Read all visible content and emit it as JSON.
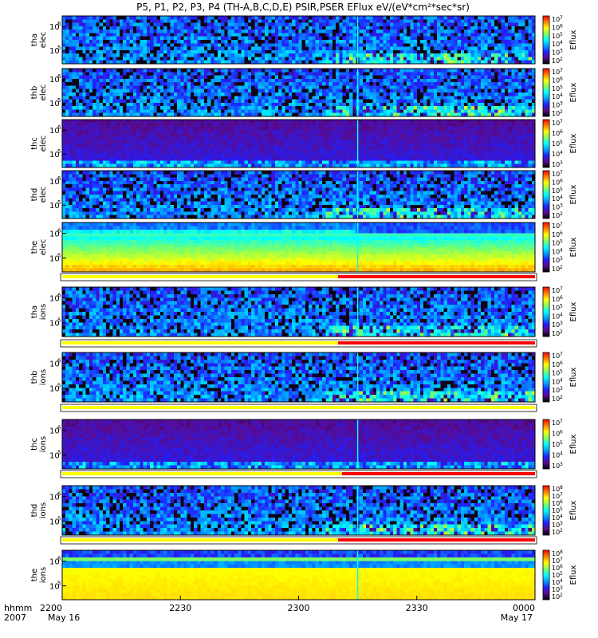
{
  "title": "P5, P1, P2, P3, P4 (TH-A,B,C,D,E) PSIR,PSER EFlux eV/(eV*cm²*sec*sr)",
  "colorbar_label": "Eflux",
  "colorbar_stops": [
    "#000000",
    "#5a0a8c",
    "#2020ff",
    "#00a0ff",
    "#00ffff",
    "#80ff60",
    "#ffff00",
    "#ff8000",
    "#ff0000"
  ],
  "bottom_axis": {
    "row1_left": "hhmm",
    "row2_left": "2007",
    "ticks": [
      "2200",
      "2230",
      "2300",
      "2330",
      "0000"
    ],
    "date_start": "May 16",
    "date_end": "May 17"
  },
  "chart_data": {
    "type": "heatmap",
    "x_range": [
      "2007-05-16 22:00",
      "2007-05-17 00:00"
    ],
    "event_time": "23:15",
    "panels": [
      {
        "ylabel_top": "tha",
        "ylabel_bot": "elec",
        "yticks": [
          "10",
          "10"
        ],
        "yexp": [
          "6",
          "5"
        ],
        "cbar_exps": [
          "7",
          "6",
          "5",
          "4",
          "3",
          "2"
        ],
        "base": "low",
        "has_status_bar": false
      },
      {
        "ylabel_top": "thb",
        "ylabel_bot": "elec",
        "yticks": [
          "10",
          "10"
        ],
        "yexp": [
          "6",
          "5"
        ],
        "cbar_exps": [
          "7",
          "6",
          "5",
          "4",
          "3",
          "2"
        ],
        "base": "low",
        "has_status_bar": false
      },
      {
        "ylabel_top": "thc",
        "ylabel_bot": "elec",
        "yticks": [
          "10",
          "10"
        ],
        "yexp": [
          "6",
          "5"
        ],
        "cbar_exps": [
          "7",
          "6",
          "5",
          "4",
          "3"
        ],
        "base": "purple",
        "has_status_bar": false
      },
      {
        "ylabel_top": "thd",
        "ylabel_bot": "elec",
        "yticks": [
          "10",
          "10"
        ],
        "yexp": [
          "6",
          "5"
        ],
        "cbar_exps": [
          "7",
          "6",
          "5",
          "4",
          "3",
          "2"
        ],
        "base": "low",
        "has_status_bar": false
      },
      {
        "ylabel_top": "the",
        "ylabel_bot": "elec",
        "yticks": [
          "10",
          "10"
        ],
        "yexp": [
          "6",
          "5"
        ],
        "cbar_exps": [
          "7",
          "6",
          "5",
          "4",
          "3",
          "2"
        ],
        "base": "sheath",
        "has_status_bar": true,
        "status_red_from": "23:10"
      },
      {
        "ylabel_top": "tha",
        "ylabel_bot": "ions",
        "yticks": [
          "10",
          "10"
        ],
        "yexp": [
          "6",
          "5"
        ],
        "cbar_exps": [
          "7",
          "6",
          "5",
          "4",
          "3",
          "2"
        ],
        "base": "low",
        "has_status_bar": true,
        "status_red_from": "23:10"
      },
      {
        "ylabel_top": "thb",
        "ylabel_bot": "ions",
        "yticks": [
          "10",
          "10"
        ],
        "yexp": [
          "6",
          "5"
        ],
        "cbar_exps": [
          "7",
          "6",
          "5",
          "4",
          "3",
          "2"
        ],
        "base": "low",
        "has_status_bar": true,
        "status_red_from": null
      },
      {
        "ylabel_top": "thc",
        "ylabel_bot": "ions",
        "yticks": [
          "10",
          "10"
        ],
        "yexp": [
          "6",
          "5"
        ],
        "cbar_exps": [
          "7",
          "6",
          "5",
          "4",
          "3"
        ],
        "base": "purple",
        "has_status_bar": true,
        "status_red_from": "23:11"
      },
      {
        "ylabel_top": "thd",
        "ylabel_bot": "ions",
        "yticks": [
          "10",
          "10"
        ],
        "yexp": [
          "6",
          "5"
        ],
        "cbar_exps": [
          "8",
          "7",
          "6",
          "5",
          "4",
          "3",
          "2"
        ],
        "base": "low",
        "has_status_bar": true,
        "status_red_from": "23:10"
      },
      {
        "ylabel_top": "the",
        "ylabel_bot": "ions",
        "yticks": [
          "10",
          "10"
        ],
        "yexp": [
          "6",
          "5"
        ],
        "cbar_exps": [
          "8",
          "7",
          "6",
          "5",
          "4",
          "3",
          "2"
        ],
        "base": "sheath_ion",
        "has_status_bar": false
      }
    ]
  }
}
